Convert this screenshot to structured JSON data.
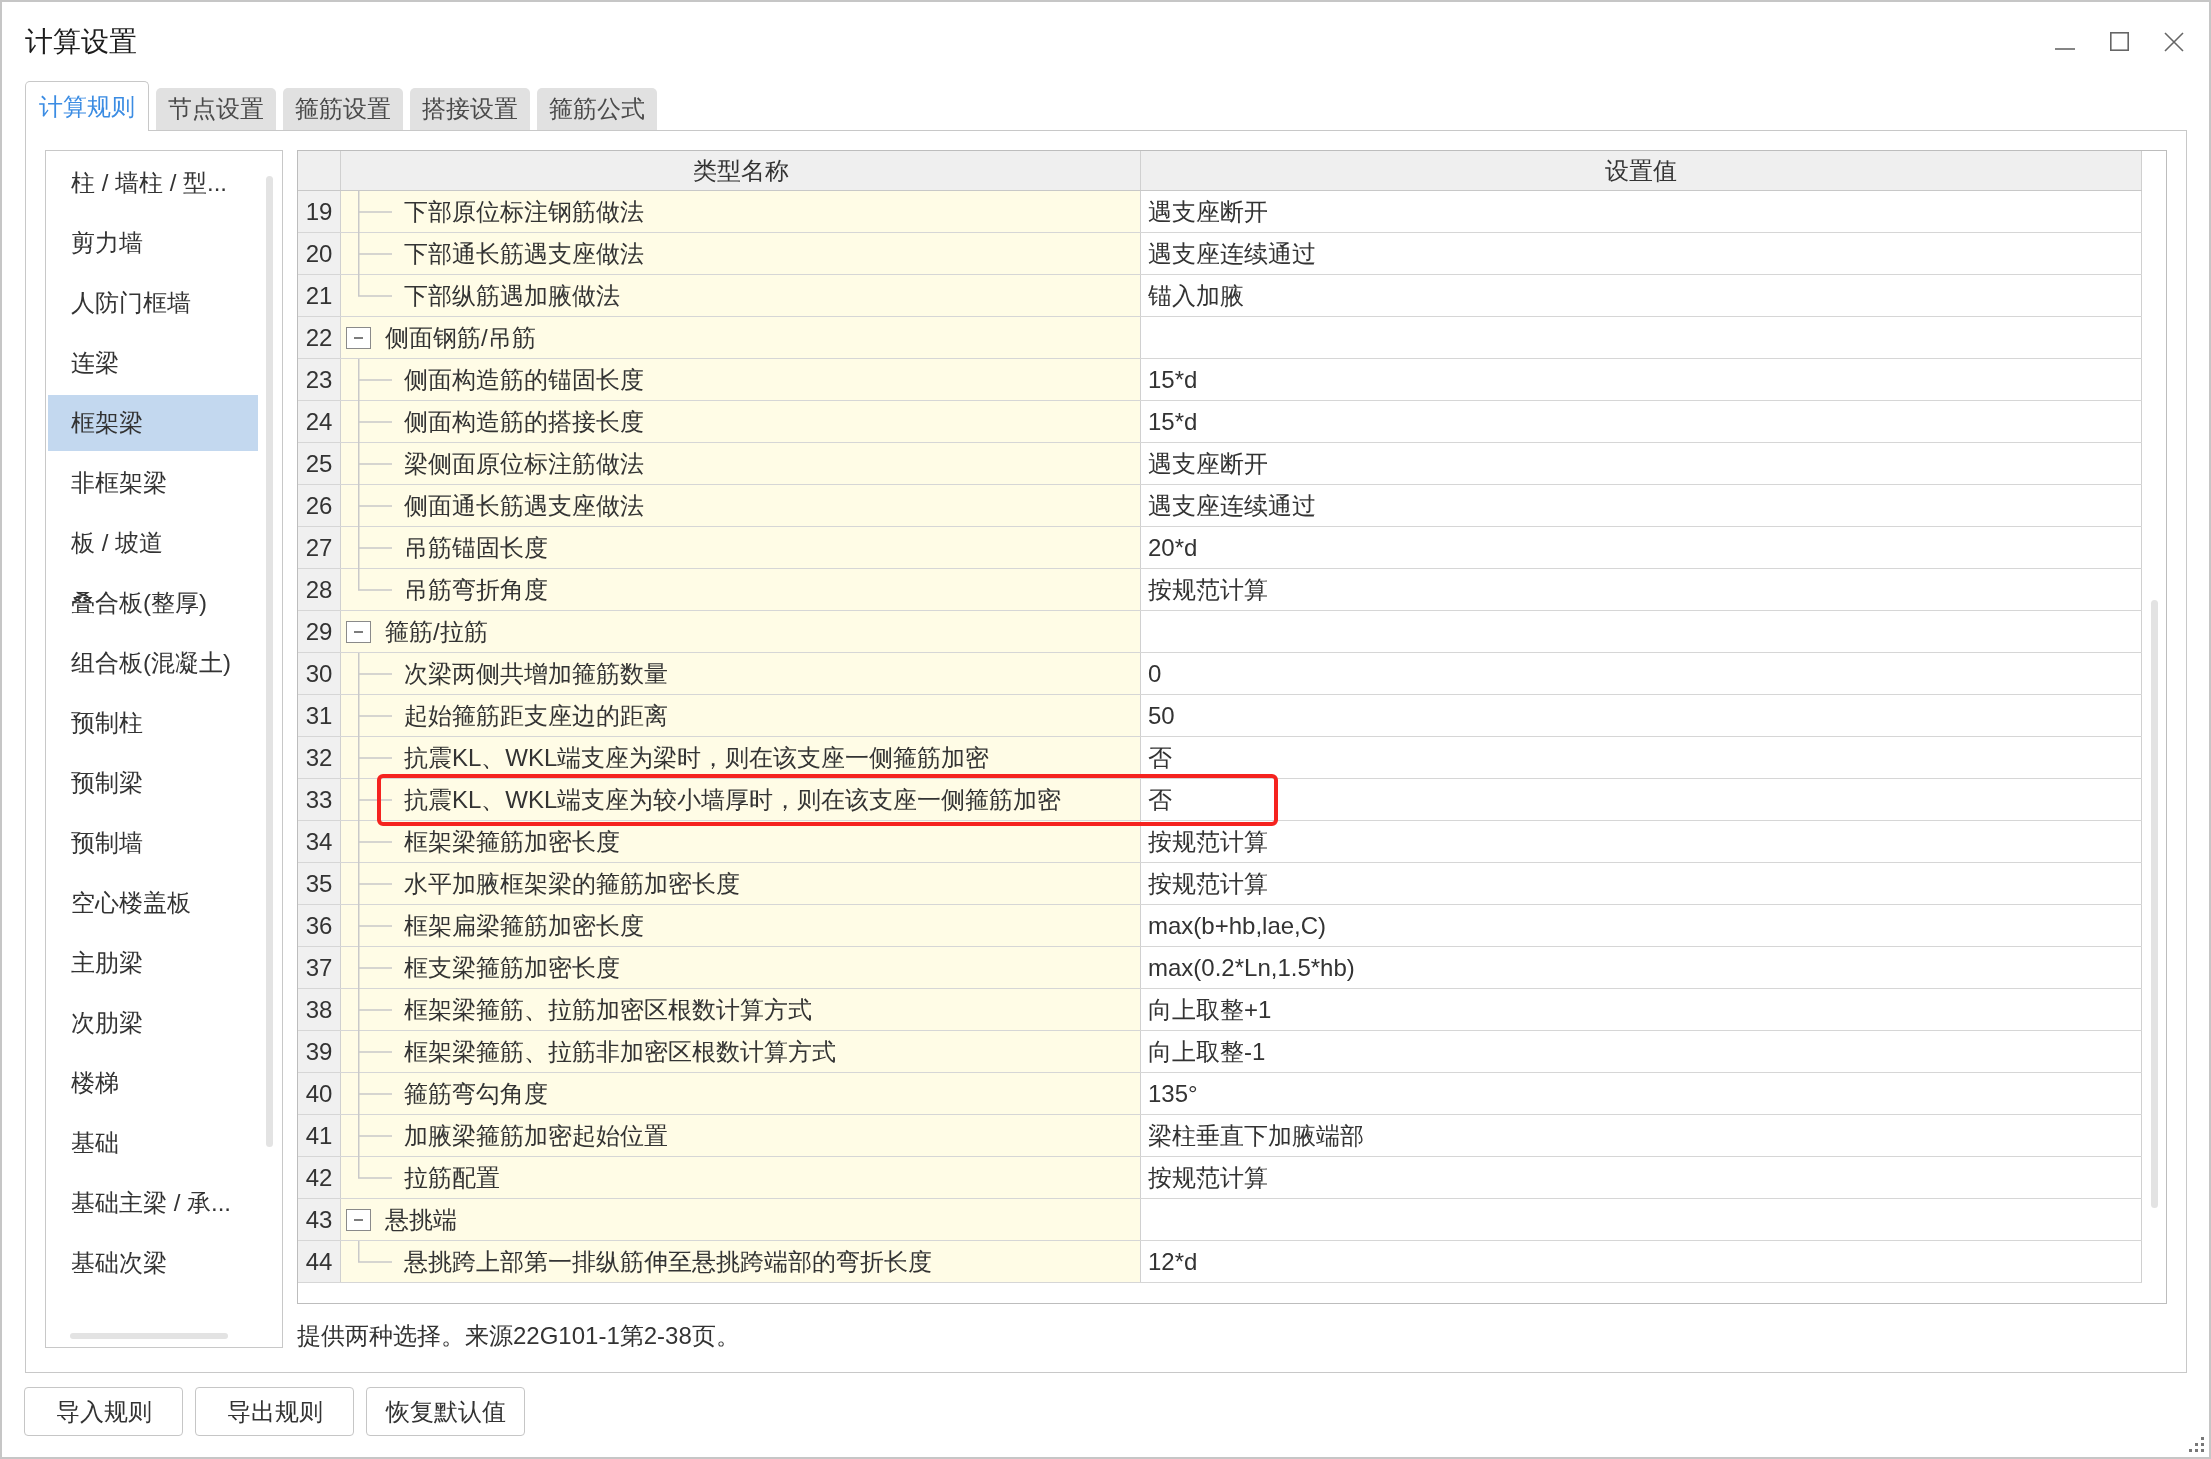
{
  "window": {
    "title": "计算设置"
  },
  "tabs": [
    {
      "label": "计算规则",
      "selected": true
    },
    {
      "label": "节点设置",
      "selected": false
    },
    {
      "label": "箍筋设置",
      "selected": false
    },
    {
      "label": "搭接设置",
      "selected": false
    },
    {
      "label": "箍筋公式",
      "selected": false
    }
  ],
  "sidebar": {
    "items": [
      {
        "label": "柱 / 墙柱 / 型...",
        "selected": false
      },
      {
        "label": "剪力墙",
        "selected": false
      },
      {
        "label": "人防门框墙",
        "selected": false
      },
      {
        "label": "连梁",
        "selected": false
      },
      {
        "label": "框架梁",
        "selected": true
      },
      {
        "label": "非框架梁",
        "selected": false
      },
      {
        "label": "板 / 坡道",
        "selected": false
      },
      {
        "label": "叠合板(整厚)",
        "selected": false
      },
      {
        "label": "组合板(混凝土)",
        "selected": false
      },
      {
        "label": "预制柱",
        "selected": false
      },
      {
        "label": "预制梁",
        "selected": false
      },
      {
        "label": "预制墙",
        "selected": false
      },
      {
        "label": "空心楼盖板",
        "selected": false
      },
      {
        "label": "主肋梁",
        "selected": false
      },
      {
        "label": "次肋梁",
        "selected": false
      },
      {
        "label": "楼梯",
        "selected": false
      },
      {
        "label": "基础",
        "selected": false
      },
      {
        "label": "基础主梁 / 承...",
        "selected": false
      },
      {
        "label": "基础次梁",
        "selected": false
      }
    ]
  },
  "table": {
    "columns": [
      "类型名称",
      "设置值"
    ],
    "rows": [
      {
        "kind": "item",
        "number": "19",
        "name": "下部原位标注钢筋做法",
        "value": "遇支座断开",
        "highlighted": false
      },
      {
        "kind": "item",
        "number": "20",
        "name": "下部通长筋遇支座做法",
        "value": "遇支座连续通过",
        "highlighted": false
      },
      {
        "kind": "item",
        "number": "21",
        "name": "下部纵筋遇加腋做法",
        "value": "锚入加腋",
        "highlighted": false
      },
      {
        "kind": "group",
        "number": "22",
        "name": "侧面钢筋/吊筋",
        "expanded": true,
        "highlighted": false,
        "children": [
          {
            "kind": "item",
            "number": "23",
            "name": "侧面构造筋的锚固长度",
            "value": "15*d",
            "highlighted": false
          },
          {
            "kind": "item",
            "number": "24",
            "name": "侧面构造筋的搭接长度",
            "value": "15*d",
            "highlighted": false
          },
          {
            "kind": "item",
            "number": "25",
            "name": "梁侧面原位标注筋做法",
            "value": "遇支座断开",
            "highlighted": false
          },
          {
            "kind": "item",
            "number": "26",
            "name": "侧面通长筋遇支座做法",
            "value": "遇支座连续通过",
            "highlighted": false
          },
          {
            "kind": "item",
            "number": "27",
            "name": "吊筋锚固长度",
            "value": "20*d",
            "highlighted": false
          },
          {
            "kind": "item",
            "number": "28",
            "name": "吊筋弯折角度",
            "value": "按规范计算",
            "highlighted": false
          }
        ]
      },
      {
        "kind": "group",
        "number": "29",
        "name": "箍筋/拉筋",
        "expanded": true,
        "highlighted": false,
        "children": [
          {
            "kind": "item",
            "number": "30",
            "name": "次梁两侧共增加箍筋数量",
            "value": "0",
            "highlighted": false
          },
          {
            "kind": "item",
            "number": "31",
            "name": "起始箍筋距支座边的距离",
            "value": "50",
            "highlighted": false
          },
          {
            "kind": "item",
            "number": "32",
            "name": "抗震KL、WKL端支座为梁时，则在该支座一侧箍筋加密",
            "value": "否",
            "highlighted": false
          },
          {
            "kind": "item",
            "number": "33",
            "name": "抗震KL、WKL端支座为较小墙厚时，则在该支座一侧箍筋加密",
            "value": "否",
            "highlighted": true
          },
          {
            "kind": "item",
            "number": "34",
            "name": "框架梁箍筋加密长度",
            "value": "按规范计算",
            "highlighted": false
          },
          {
            "kind": "item",
            "number": "35",
            "name": "水平加腋框架梁的箍筋加密长度",
            "value": "按规范计算",
            "highlighted": false
          },
          {
            "kind": "item",
            "number": "36",
            "name": "框架扁梁箍筋加密长度",
            "value": "max(b+hb,lae,C)",
            "highlighted": false
          },
          {
            "kind": "item",
            "number": "37",
            "name": "框支梁箍筋加密长度",
            "value": "max(0.2*Ln,1.5*hb)",
            "highlighted": false
          },
          {
            "kind": "item",
            "number": "38",
            "name": "框架梁箍筋、拉筋加密区根数计算方式",
            "value": "向上取整+1",
            "highlighted": false
          },
          {
            "kind": "item",
            "number": "39",
            "name": "框架梁箍筋、拉筋非加密区根数计算方式",
            "value": "向上取整-1",
            "highlighted": false
          },
          {
            "kind": "item",
            "number": "40",
            "name": "箍筋弯勾角度",
            "value": "135°",
            "highlighted": false
          },
          {
            "kind": "item",
            "number": "41",
            "name": "加腋梁箍筋加密起始位置",
            "value": "梁柱垂直下加腋端部",
            "highlighted": false
          },
          {
            "kind": "item",
            "number": "42",
            "name": "拉筋配置",
            "value": "按规范计算",
            "highlighted": false
          }
        ]
      },
      {
        "kind": "group",
        "number": "43",
        "name": "悬挑端",
        "expanded": true,
        "highlighted": false,
        "children": [
          {
            "kind": "item",
            "number": "44",
            "name": "悬挑跨上部第一排纵筋伸至悬挑跨端部的弯折长度",
            "value": "12*d",
            "highlighted": false
          }
        ]
      }
    ]
  },
  "description": "提供两种选择。来源22G101-1第2-38页。",
  "buttons": [
    "导入规则",
    "导出规则",
    "恢复默认值"
  ]
}
